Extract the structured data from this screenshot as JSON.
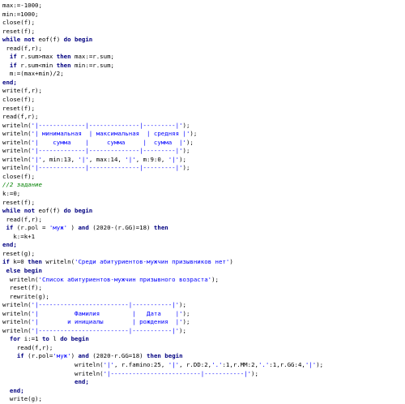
{
  "editor": {
    "lines": [
      {
        "indent": "",
        "segments": [
          {
            "t": "max:=-1000;",
            "k": "p"
          }
        ]
      },
      {
        "indent": "",
        "segments": [
          {
            "t": "min:=1000;",
            "k": "p"
          }
        ]
      },
      {
        "indent": "",
        "segments": [
          {
            "t": "close(f);",
            "k": "p"
          }
        ]
      },
      {
        "indent": "",
        "segments": [
          {
            "t": "reset(f);",
            "k": "p"
          }
        ]
      },
      {
        "indent": "",
        "segments": [
          {
            "t": "while not",
            "k": "kw"
          },
          {
            "t": " eof(f) ",
            "k": "p"
          },
          {
            "t": "do begin",
            "k": "kw"
          }
        ]
      },
      {
        "indent": " ",
        "segments": [
          {
            "t": "read(f,r);",
            "k": "p"
          }
        ]
      },
      {
        "indent": "  ",
        "segments": [
          {
            "t": "if",
            "k": "kw"
          },
          {
            "t": " r.sum>max ",
            "k": "p"
          },
          {
            "t": "then",
            "k": "kw"
          },
          {
            "t": " max:=r.sum;",
            "k": "p"
          }
        ]
      },
      {
        "indent": "  ",
        "segments": [
          {
            "t": "if",
            "k": "kw"
          },
          {
            "t": " r.sum<min ",
            "k": "p"
          },
          {
            "t": "then",
            "k": "kw"
          },
          {
            "t": " min:=r.sum;",
            "k": "p"
          }
        ]
      },
      {
        "indent": "  ",
        "segments": [
          {
            "t": "m:=(max+min)/2;",
            "k": "p"
          }
        ]
      },
      {
        "indent": "",
        "segments": [
          {
            "t": "end;",
            "k": "kw"
          }
        ]
      },
      {
        "indent": "",
        "segments": [
          {
            "t": "write(f,r);",
            "k": "p"
          }
        ]
      },
      {
        "indent": "",
        "segments": [
          {
            "t": "close(f);",
            "k": "p"
          }
        ]
      },
      {
        "indent": "",
        "segments": [
          {
            "t": "reset(f);",
            "k": "p"
          }
        ]
      },
      {
        "indent": "",
        "segments": [
          {
            "t": "read(f,r);",
            "k": "p"
          }
        ]
      },
      {
        "indent": "",
        "segments": [
          {
            "t": "writeln(",
            "k": "p"
          },
          {
            "t": "'|-------------|--------------|---------|'",
            "k": "str"
          },
          {
            "t": ");",
            "k": "p"
          }
        ]
      },
      {
        "indent": "",
        "segments": [
          {
            "t": "writeln(",
            "k": "p"
          },
          {
            "t": "'| минимальная  | максимальная  | средняя |'",
            "k": "str"
          },
          {
            "t": ");",
            "k": "p"
          }
        ]
      },
      {
        "indent": "",
        "segments": [
          {
            "t": "writeln(",
            "k": "p"
          },
          {
            "t": "'|    сумма    |     сумма     |  сумма  |'",
            "k": "str"
          },
          {
            "t": ");",
            "k": "p"
          }
        ]
      },
      {
        "indent": "",
        "segments": [
          {
            "t": "writeln(",
            "k": "p"
          },
          {
            "t": "'|-------------|--------------|---------|'",
            "k": "str"
          },
          {
            "t": ");",
            "k": "p"
          }
        ]
      },
      {
        "indent": "",
        "segments": [
          {
            "t": "writeln(",
            "k": "p"
          },
          {
            "t": "'|'",
            "k": "str"
          },
          {
            "t": ", min:13, ",
            "k": "p"
          },
          {
            "t": "'|'",
            "k": "str"
          },
          {
            "t": ", max:14, ",
            "k": "p"
          },
          {
            "t": "'|'",
            "k": "str"
          },
          {
            "t": ", m:9:0, ",
            "k": "p"
          },
          {
            "t": "'|'",
            "k": "str"
          },
          {
            "t": ");",
            "k": "p"
          }
        ]
      },
      {
        "indent": "",
        "segments": [
          {
            "t": "writeln(",
            "k": "p"
          },
          {
            "t": "'|-------------|--------------|---------|'",
            "k": "str"
          },
          {
            "t": ");",
            "k": "p"
          }
        ]
      },
      {
        "indent": "",
        "segments": [
          {
            "t": "close(f);",
            "k": "p"
          }
        ]
      },
      {
        "indent": "",
        "segments": [
          {
            "t": "//2 задание",
            "k": "cm"
          }
        ]
      },
      {
        "indent": "",
        "segments": [
          {
            "t": "k:=0;",
            "k": "p"
          }
        ]
      },
      {
        "indent": "",
        "segments": [
          {
            "t": "reset(f);",
            "k": "p"
          }
        ]
      },
      {
        "indent": "",
        "segments": [
          {
            "t": "while not",
            "k": "kw"
          },
          {
            "t": " eof(f) ",
            "k": "p"
          },
          {
            "t": "do begin",
            "k": "kw"
          }
        ]
      },
      {
        "indent": " ",
        "segments": [
          {
            "t": "read(f,r);",
            "k": "p"
          }
        ]
      },
      {
        "indent": " ",
        "segments": [
          {
            "t": "if",
            "k": "kw"
          },
          {
            "t": " (r.pol = ",
            "k": "p"
          },
          {
            "t": "'муж'",
            "k": "str"
          },
          {
            "t": " ) ",
            "k": "p"
          },
          {
            "t": "and",
            "k": "kw"
          },
          {
            "t": " (2020-(r.GG)=18) ",
            "k": "p"
          },
          {
            "t": "then",
            "k": "kw"
          }
        ]
      },
      {
        "indent": "   ",
        "segments": [
          {
            "t": "k:=k+1",
            "k": "p"
          }
        ]
      },
      {
        "indent": "",
        "segments": [
          {
            "t": "end;",
            "k": "kw"
          }
        ]
      },
      {
        "indent": "",
        "segments": [
          {
            "t": "reset(g);",
            "k": "p"
          }
        ]
      },
      {
        "indent": "",
        "segments": [
          {
            "t": "if",
            "k": "kw"
          },
          {
            "t": " k=0 ",
            "k": "p"
          },
          {
            "t": "then",
            "k": "kw"
          },
          {
            "t": " writeln(",
            "k": "p"
          },
          {
            "t": "'Среди абитуриентов-мужчин призывников нет'",
            "k": "str"
          },
          {
            "t": ")",
            "k": "p"
          }
        ]
      },
      {
        "indent": " ",
        "segments": [
          {
            "t": "else begin",
            "k": "kw"
          }
        ]
      },
      {
        "indent": "  ",
        "segments": [
          {
            "t": "writeln(",
            "k": "p"
          },
          {
            "t": "'Список абитуриентов-мужчин призывного возраста'",
            "k": "str"
          },
          {
            "t": ");",
            "k": "p"
          }
        ]
      },
      {
        "indent": "  ",
        "segments": [
          {
            "t": "reset(f);",
            "k": "p"
          }
        ]
      },
      {
        "indent": "  ",
        "segments": [
          {
            "t": "rewrite(g);",
            "k": "p"
          }
        ]
      },
      {
        "indent": "",
        "segments": [
          {
            "t": "writeln(",
            "k": "p"
          },
          {
            "t": "'|-------------------------|-----------|'",
            "k": "str"
          },
          {
            "t": ");",
            "k": "p"
          }
        ]
      },
      {
        "indent": "",
        "segments": [
          {
            "t": "writeln(",
            "k": "p"
          },
          {
            "t": "'|          Фамилия         |   Дата    |'",
            "k": "str"
          },
          {
            "t": ");",
            "k": "p"
          }
        ]
      },
      {
        "indent": "",
        "segments": [
          {
            "t": "writeln(",
            "k": "p"
          },
          {
            "t": "'|        и инициалы        | рождения  |'",
            "k": "str"
          },
          {
            "t": ");",
            "k": "p"
          }
        ]
      },
      {
        "indent": "",
        "segments": [
          {
            "t": "writeln(",
            "k": "p"
          },
          {
            "t": "'|-------------------------|-----------|'",
            "k": "str"
          },
          {
            "t": ");",
            "k": "p"
          }
        ]
      },
      {
        "indent": "  ",
        "segments": [
          {
            "t": "for",
            "k": "kw"
          },
          {
            "t": " i:=1 ",
            "k": "p"
          },
          {
            "t": "to",
            "k": "kw"
          },
          {
            "t": " l ",
            "k": "p"
          },
          {
            "t": "do begin",
            "k": "kw"
          }
        ]
      },
      {
        "indent": "    ",
        "segments": [
          {
            "t": "read(f,r);",
            "k": "p"
          }
        ]
      },
      {
        "indent": "    ",
        "segments": [
          {
            "t": "if",
            "k": "kw"
          },
          {
            "t": " (r.pol=",
            "k": "p"
          },
          {
            "t": "'муж'",
            "k": "str"
          },
          {
            "t": ") ",
            "k": "p"
          },
          {
            "t": "and",
            "k": "kw"
          },
          {
            "t": " (2020-r.GG=18) ",
            "k": "p"
          },
          {
            "t": "then begin",
            "k": "kw"
          }
        ]
      },
      {
        "indent": "                    ",
        "segments": [
          {
            "t": "writeln(",
            "k": "p"
          },
          {
            "t": "'|'",
            "k": "str"
          },
          {
            "t": ", r.famino:25, ",
            "k": "p"
          },
          {
            "t": "'|'",
            "k": "str"
          },
          {
            "t": ", r.DD:2,",
            "k": "p"
          },
          {
            "t": "'.'",
            "k": "str"
          },
          {
            "t": ":1,r.MM:2,",
            "k": "p"
          },
          {
            "t": "'.'",
            "k": "str"
          },
          {
            "t": ":1,r.GG:4,",
            "k": "p"
          },
          {
            "t": "'|'",
            "k": "str"
          },
          {
            "t": ");",
            "k": "p"
          }
        ]
      },
      {
        "indent": "                    ",
        "segments": [
          {
            "t": "writeln(",
            "k": "p"
          },
          {
            "t": "'|-------------------------|-----------|'",
            "k": "str"
          },
          {
            "t": ");",
            "k": "p"
          }
        ]
      },
      {
        "indent": "                    ",
        "segments": [
          {
            "t": "end;",
            "k": "kw"
          }
        ]
      },
      {
        "indent": "  ",
        "segments": [
          {
            "t": "end;",
            "k": "kw"
          }
        ]
      },
      {
        "indent": "  ",
        "segments": [
          {
            "t": "write(g);",
            "k": "p"
          }
        ]
      }
    ]
  }
}
